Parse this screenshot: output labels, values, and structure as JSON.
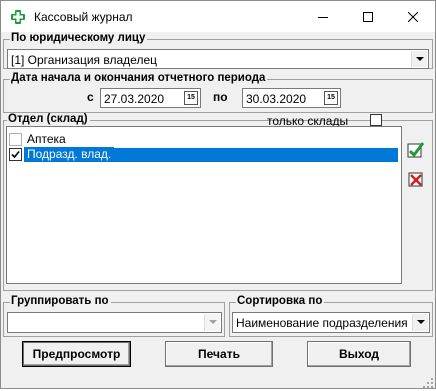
{
  "window": {
    "title": "Кассовый журнал",
    "icon": "green-cross-icon",
    "controls": [
      "minimize",
      "maximize",
      "close"
    ]
  },
  "legal_entity": {
    "legend": "По юридическому лицу",
    "selected": "[1] Организация владелец"
  },
  "period": {
    "legend": "Дата начала и окончания отчетного периода",
    "from_label": "с",
    "from_value": "27.03.2020",
    "to_label": "по",
    "to_value": "30.03.2020",
    "calendar_glyph": "15"
  },
  "department": {
    "legend": "Отдел (склад)",
    "only_warehouses_label": "только склады",
    "only_warehouses_checked": false,
    "items": [
      {
        "label": "Аптека",
        "checked": false,
        "selected": false
      },
      {
        "label": "Подразд. влад.",
        "checked": true,
        "selected": true
      }
    ],
    "check_all_icon": "green-check-icon",
    "uncheck_all_icon": "red-cross-icon"
  },
  "group_by": {
    "legend": "Группировать по",
    "selected": ""
  },
  "sort_by": {
    "legend": "Сортировка по",
    "selected": "Наименование подразделения"
  },
  "buttons": {
    "preview": "Предпросмотр",
    "print": "Печать",
    "exit": "Выход"
  },
  "colors": {
    "selection": "#0078d7",
    "window_bg": "#f0f0f0",
    "icon_green": "#1e9a3a"
  }
}
